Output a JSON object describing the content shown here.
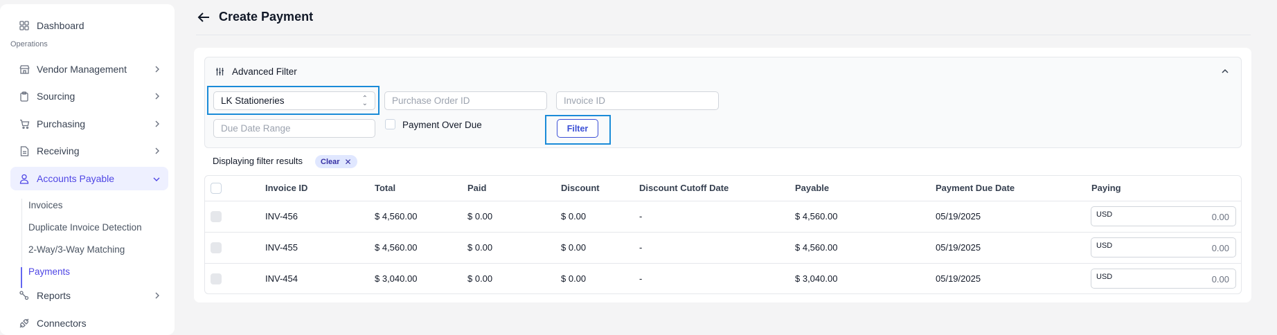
{
  "sidebar": {
    "dashboard": "Dashboard",
    "section_operations": "Operations",
    "vendor_management": "Vendor Management",
    "sourcing": "Sourcing",
    "purchasing": "Purchasing",
    "receiving": "Receiving",
    "accounts_payable": "Accounts Payable",
    "sub_items": [
      "Invoices",
      "Duplicate Invoice Detection",
      "2-Way/3-Way Matching",
      "Payments"
    ],
    "reports": "Reports",
    "connectors": "Connectors"
  },
  "header": {
    "title": "Create Payment"
  },
  "filter": {
    "title": "Advanced Filter",
    "vendor_selected": "LK Stationeries",
    "po_placeholder": "Purchase Order ID",
    "invoice_placeholder": "Invoice ID",
    "due_date_placeholder": "Due Date Range",
    "overdue_label": "Payment Over Due",
    "filter_button": "Filter"
  },
  "results": {
    "text": "Displaying filter results",
    "clear_label": "Clear"
  },
  "table": {
    "headers": [
      "Invoice ID",
      "Total",
      "Paid",
      "Discount",
      "Discount Cutoff Date",
      "Payable",
      "Payment Due Date",
      "Paying"
    ],
    "rows": [
      {
        "invoice_id": "INV-456",
        "total": "$ 4,560.00",
        "paid": "$ 0.00",
        "discount": "$ 0.00",
        "cutoff": "-",
        "payable": "$ 4,560.00",
        "due": "05/19/2025",
        "currency": "USD",
        "paying": "0.00"
      },
      {
        "invoice_id": "INV-455",
        "total": "$ 4,560.00",
        "paid": "$ 0.00",
        "discount": "$ 0.00",
        "cutoff": "-",
        "payable": "$ 4,560.00",
        "due": "05/19/2025",
        "currency": "USD",
        "paying": "0.00"
      },
      {
        "invoice_id": "INV-454",
        "total": "$ 3,040.00",
        "paid": "$ 0.00",
        "discount": "$ 0.00",
        "cutoff": "-",
        "payable": "$ 3,040.00",
        "due": "05/19/2025",
        "currency": "USD",
        "paying": "0.00"
      }
    ]
  },
  "colors": {
    "accent": "#4f46e5",
    "focus_outline": "#1a8bd8",
    "chip_bg": "#e0e7ff"
  },
  "icons": {
    "dashboard": "grid-icon",
    "vendor": "store-icon",
    "sourcing": "clipboard-icon",
    "purchasing": "cart-icon",
    "receiving": "document-icon",
    "accounts_payable": "user-icon",
    "reports": "chart-icon",
    "connectors": "plug-icon"
  }
}
